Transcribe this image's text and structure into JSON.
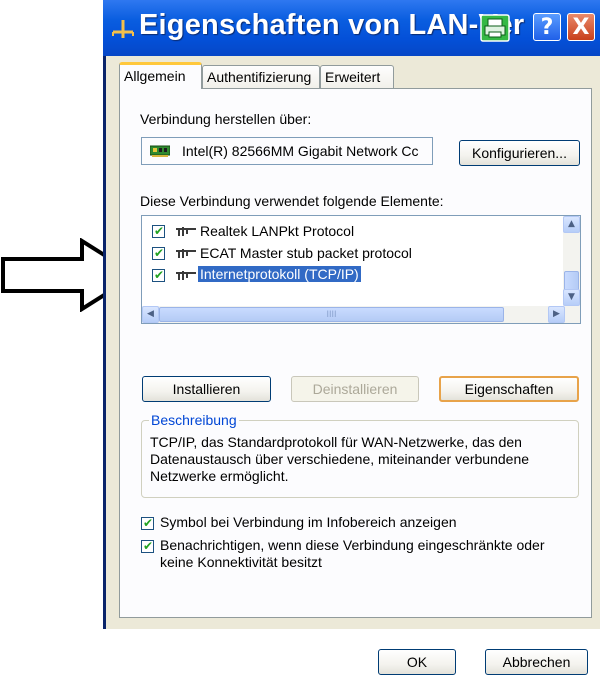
{
  "window": {
    "title": "Eigenschaften von LAN-Ver",
    "title_dot": ".",
    "help_label": "?",
    "close_label": "X"
  },
  "tabs": [
    {
      "label": "Allgemein",
      "active": true
    },
    {
      "label": "Authentifizierung",
      "active": false
    },
    {
      "label": "Erweitert",
      "active": false
    }
  ],
  "connection": {
    "label": "Verbindung herstellen über:",
    "adapter": "Intel(R) 82566MM Gigabit Network Cc",
    "configure_button": "Konfigurieren..."
  },
  "components": {
    "label": "Diese Verbindung verwendet folgende Elemente:",
    "items": [
      {
        "label": "Realtek LANPkt Protocol",
        "checked": true,
        "selected": false
      },
      {
        "label": "ECAT Master stub packet protocol",
        "checked": true,
        "selected": false
      },
      {
        "label": "Internetprotokoll (TCP/IP)",
        "checked": true,
        "selected": true
      }
    ],
    "scroll_grip": "IIII"
  },
  "actions": {
    "install": "Installieren",
    "uninstall": "Deinstallieren",
    "properties": "Eigenschaften"
  },
  "description": {
    "title": "Beschreibung",
    "lines": [
      "TCP/IP, das Standardprotokoll für WAN-Netzwerke, das den",
      "Datenaustausch über verschiedene, miteinander verbundene",
      "Netzwerke ermöglicht."
    ]
  },
  "options": [
    {
      "lines": [
        "Symbol bei Verbindung im Infobereich anzeigen"
      ],
      "checked": true
    },
    {
      "lines": [
        "Benachrichtigen, wenn diese Verbindung eingeschränkte oder",
        "keine Konnektivität besitzt"
      ],
      "checked": true
    }
  ],
  "footer": {
    "ok": "OK",
    "cancel": "Abbrechen"
  },
  "colors": {
    "titlebar": "#0450d8",
    "selection": "#316ac5",
    "dialog_bg": "#ece9d8",
    "default_button_border": "#e8a34a",
    "group_title": "#0046d5"
  },
  "icons": {
    "title": "network-connection-icon",
    "adapter": "network-card-icon",
    "protocol": "network-protocol-icon",
    "pointer": "pointer-arrow"
  }
}
